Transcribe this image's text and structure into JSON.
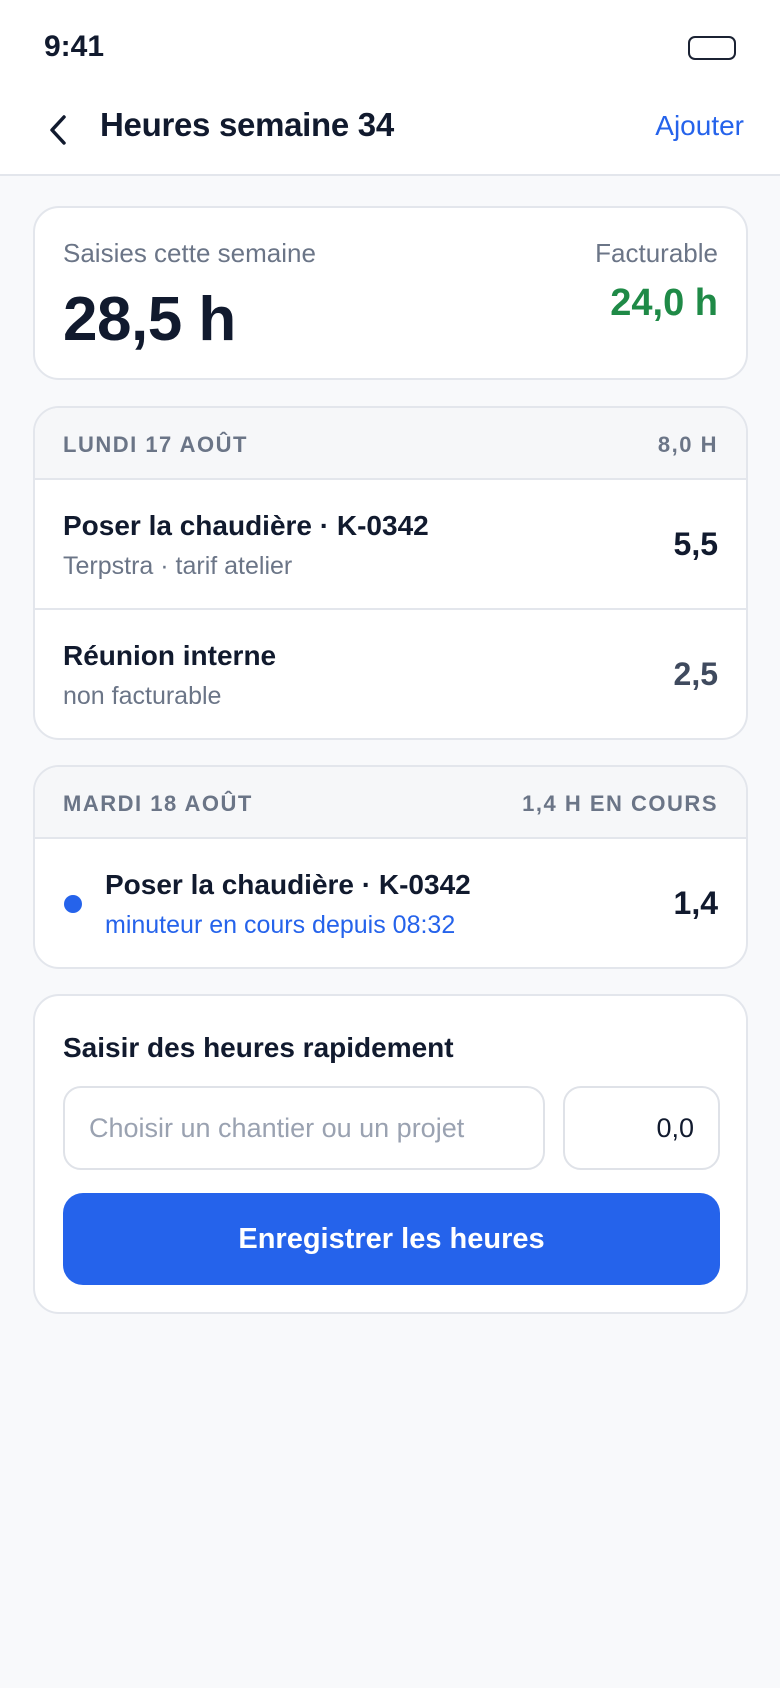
{
  "status_bar": {
    "time": "9:41",
    "battery_icon": "battery-icon"
  },
  "nav": {
    "title": "Heures semaine 34",
    "back_icon": "chevron-left-icon",
    "add_label": "Ajouter"
  },
  "summary": {
    "entered_label": "Saisies cette semaine",
    "entered_value": "28,5 h",
    "billable_label": "Facturable",
    "billable_value": "24,0 h"
  },
  "days": [
    {
      "date": "LUNDI 17 AOÛT",
      "total": "8,0 H",
      "entries": [
        {
          "name": "Poser la chaudière · K-0342",
          "detail": "Terpstra · tarif atelier",
          "hours": "5,5"
        },
        {
          "name": "Réunion interne",
          "detail": "non facturable",
          "hours": "2,5"
        }
      ]
    },
    {
      "date": "MARDI 18 AOÛT",
      "total": "1,4 H EN COURS",
      "entries": [
        {
          "name": "Poser la chaudière · K-0342",
          "detail": "minuteur en cours depuis 08:32",
          "hours": "1,4",
          "running": true
        }
      ]
    }
  ],
  "quick_entry": {
    "title": "Saisir des heures rapidement",
    "project_placeholder": "Choisir un chantier ou un projet",
    "hours_value": "0,0",
    "submit_label": "Enregistrer les heures"
  },
  "colors": {
    "accent": "#2563eb",
    "billable": "#1f8a47",
    "text": "#111a2e",
    "muted": "#6b7587"
  }
}
